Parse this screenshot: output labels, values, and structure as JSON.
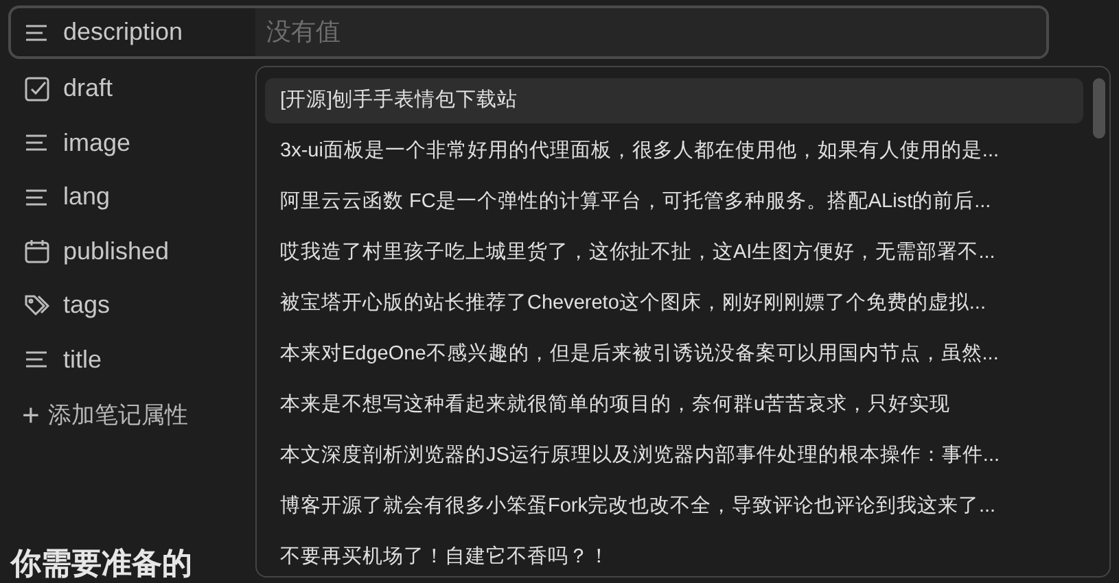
{
  "properties": [
    {
      "name": "description",
      "kind": "text",
      "selected": true,
      "placeholder": "没有值"
    },
    {
      "name": "draft",
      "kind": "checkbox",
      "selected": false
    },
    {
      "name": "image",
      "kind": "text",
      "selected": false
    },
    {
      "name": "lang",
      "kind": "text",
      "selected": false
    },
    {
      "name": "published",
      "kind": "date",
      "selected": false
    },
    {
      "name": "tags",
      "kind": "tags",
      "selected": false
    },
    {
      "name": "title",
      "kind": "text",
      "selected": false
    }
  ],
  "add_property": {
    "icon": "+",
    "label": "添加笔记属性"
  },
  "heading": "你需要准备的",
  "suggestions": [
    {
      "text": "[开源]刨手手表情包下载站",
      "selected": true
    },
    {
      "text": "3x-ui面板是一个非常好用的代理面板，很多人都在使用他，如果有人使用的是...",
      "selected": false
    },
    {
      "text": "阿里云云函数 FC是一个弹性的计算平台，可托管多种服务。搭配AList的前后...",
      "selected": false
    },
    {
      "text": "哎我造了村里孩子吃上城里货了，这你扯不扯，这AI生图方便好，无需部署不...",
      "selected": false
    },
    {
      "text": "被宝塔开心版的站长推荐了Chevereto这个图床，刚好刚刚嫖了个免费的虚拟...",
      "selected": false
    },
    {
      "text": "本来对EdgeOne不感兴趣的，但是后来被引诱说没备案可以用国内节点，虽然...",
      "selected": false
    },
    {
      "text": "本来是不想写这种看起来就很简单的项目的，奈何群u苦苦哀求，只好实现",
      "selected": false
    },
    {
      "text": "本文深度剖析浏览器的JS运行原理以及浏览器内部事件处理的根本操作：事件...",
      "selected": false
    },
    {
      "text": "博客开源了就会有很多小笨蛋Fork完改也改不全，导致评论也评论到我这来了...",
      "selected": false
    },
    {
      "text": "不要再买机场了！自建它不香吗？！",
      "selected": false
    }
  ]
}
